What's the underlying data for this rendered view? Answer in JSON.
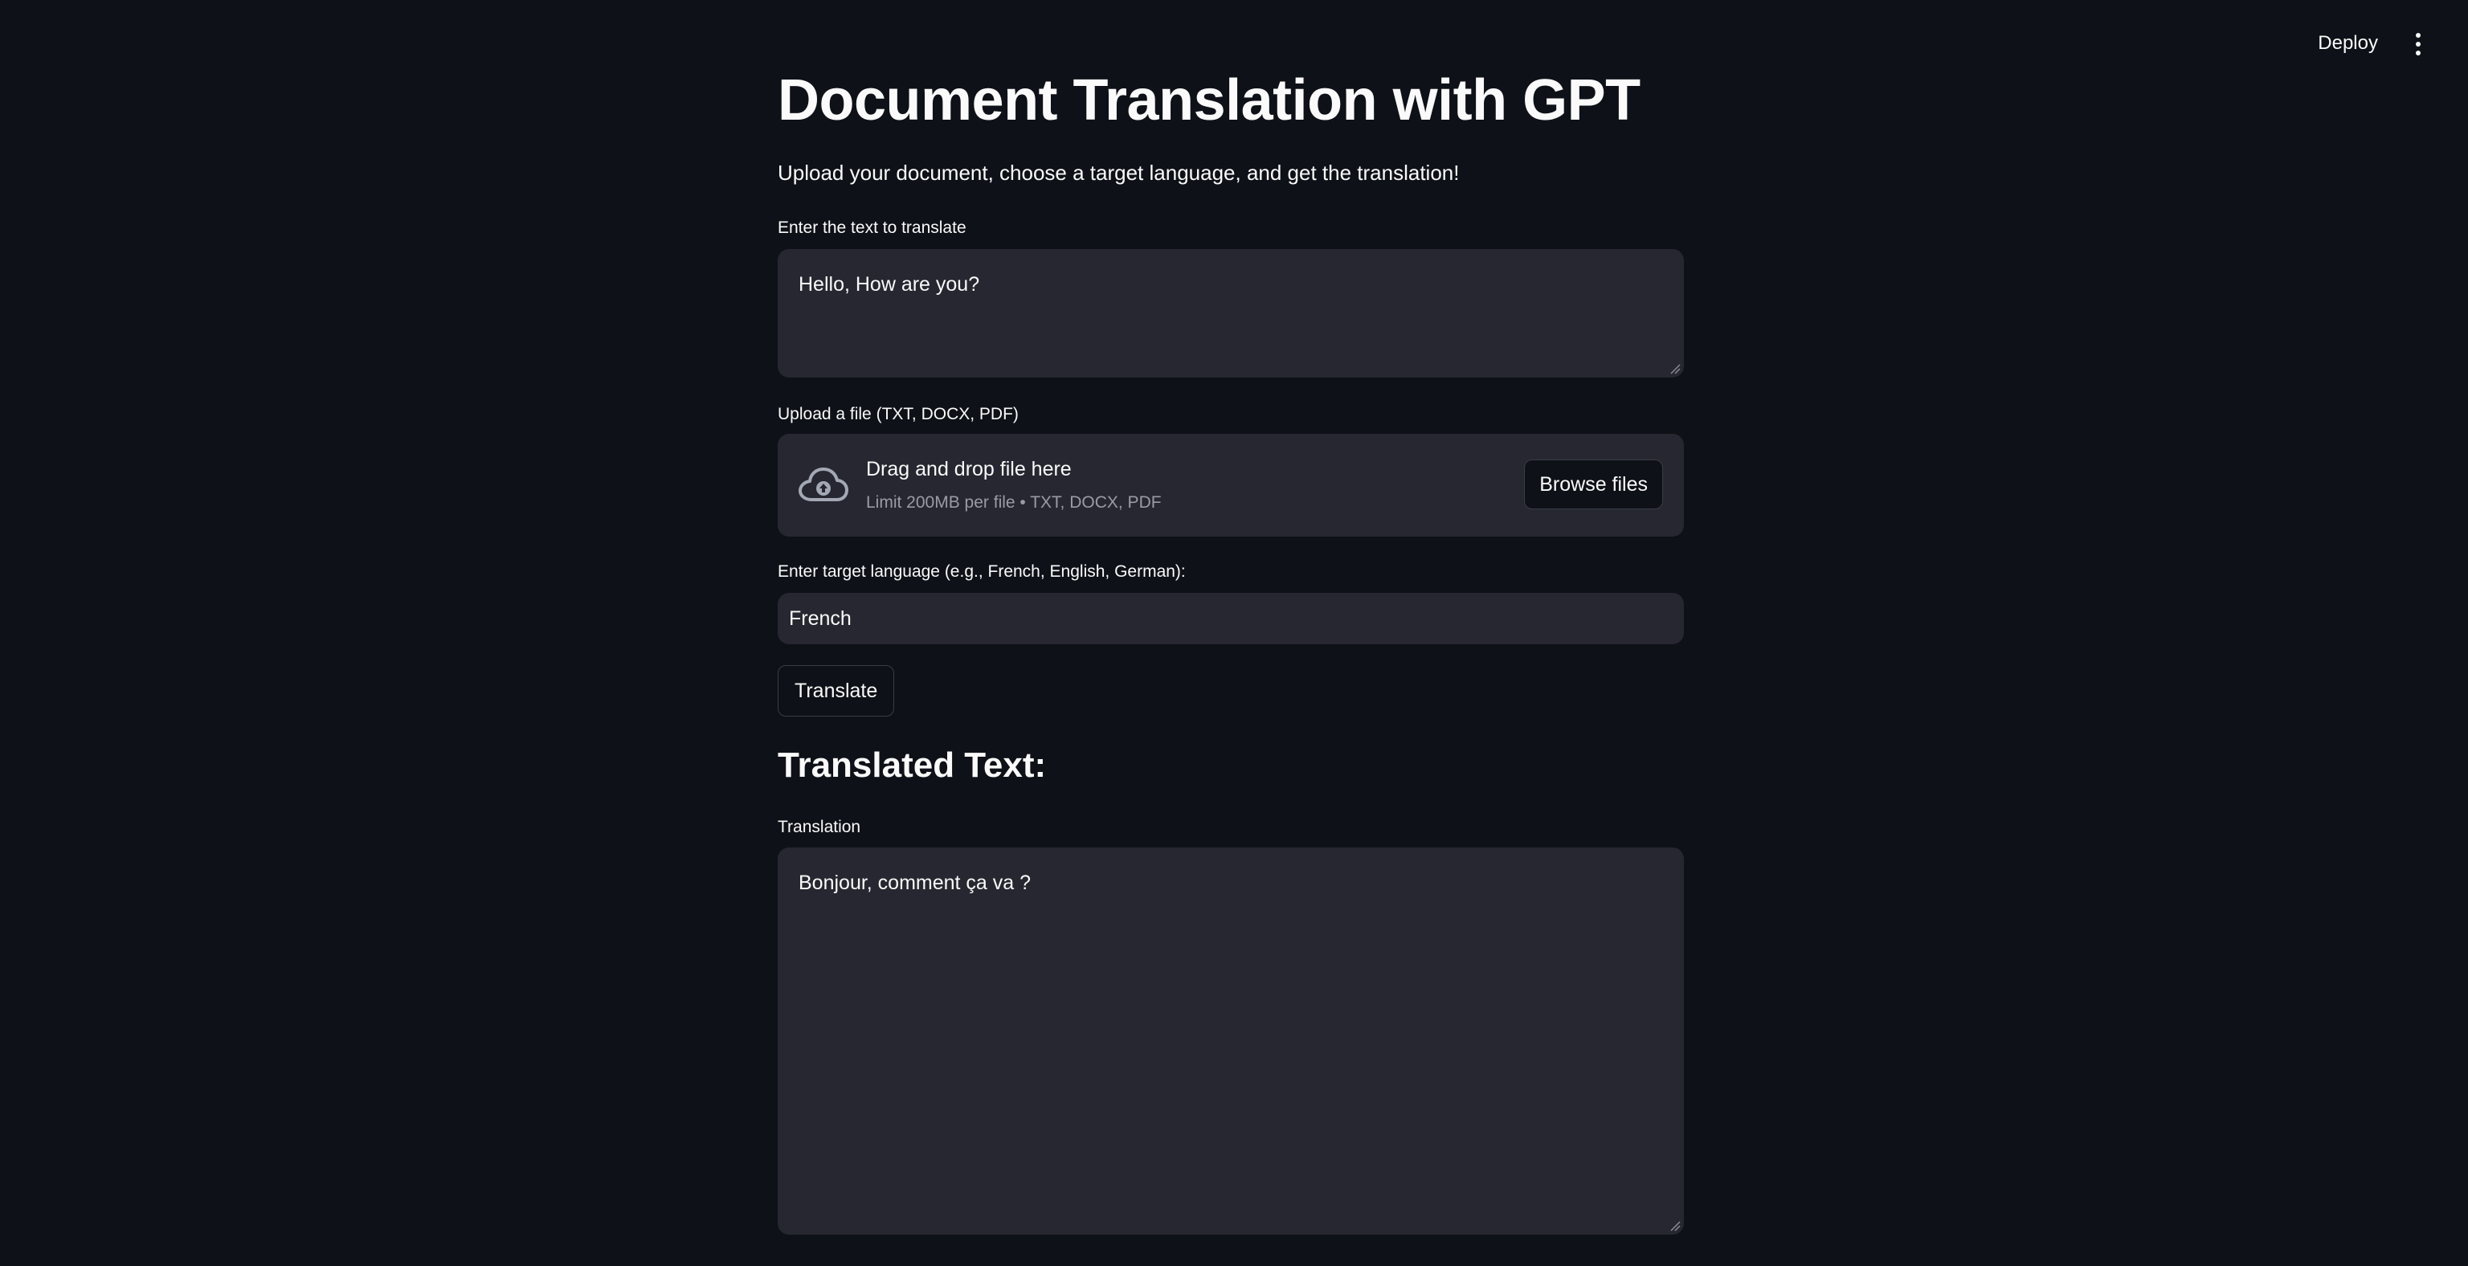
{
  "header": {
    "deploy_label": "Deploy",
    "menu_icon": "kebab-menu-icon"
  },
  "main": {
    "title": "Document Translation with GPT",
    "subtitle": "Upload your document, choose a target language, and get the translation!",
    "source_text": {
      "label": "Enter the text to translate",
      "value": "Hello, How are you?"
    },
    "uploader": {
      "label": "Upload a file (TXT, DOCX, PDF)",
      "drop_text": "Drag and drop file here",
      "limit_text": "Limit 200MB per file • TXT, DOCX, PDF",
      "browse_label": "Browse files",
      "icon": "cloud-upload-icon"
    },
    "target_language": {
      "label": "Enter target language (e.g., French, English, German):",
      "value": "French"
    },
    "translate_label": "Translate",
    "result_heading": "Translated Text:",
    "translation": {
      "label": "Translation",
      "value": "Bonjour, comment ça va ?"
    }
  },
  "colors": {
    "background": "#0e1117",
    "input_background": "#262730",
    "text": "#fafafa",
    "muted_text": "#9a9ca5",
    "border": "#3b3d47"
  }
}
